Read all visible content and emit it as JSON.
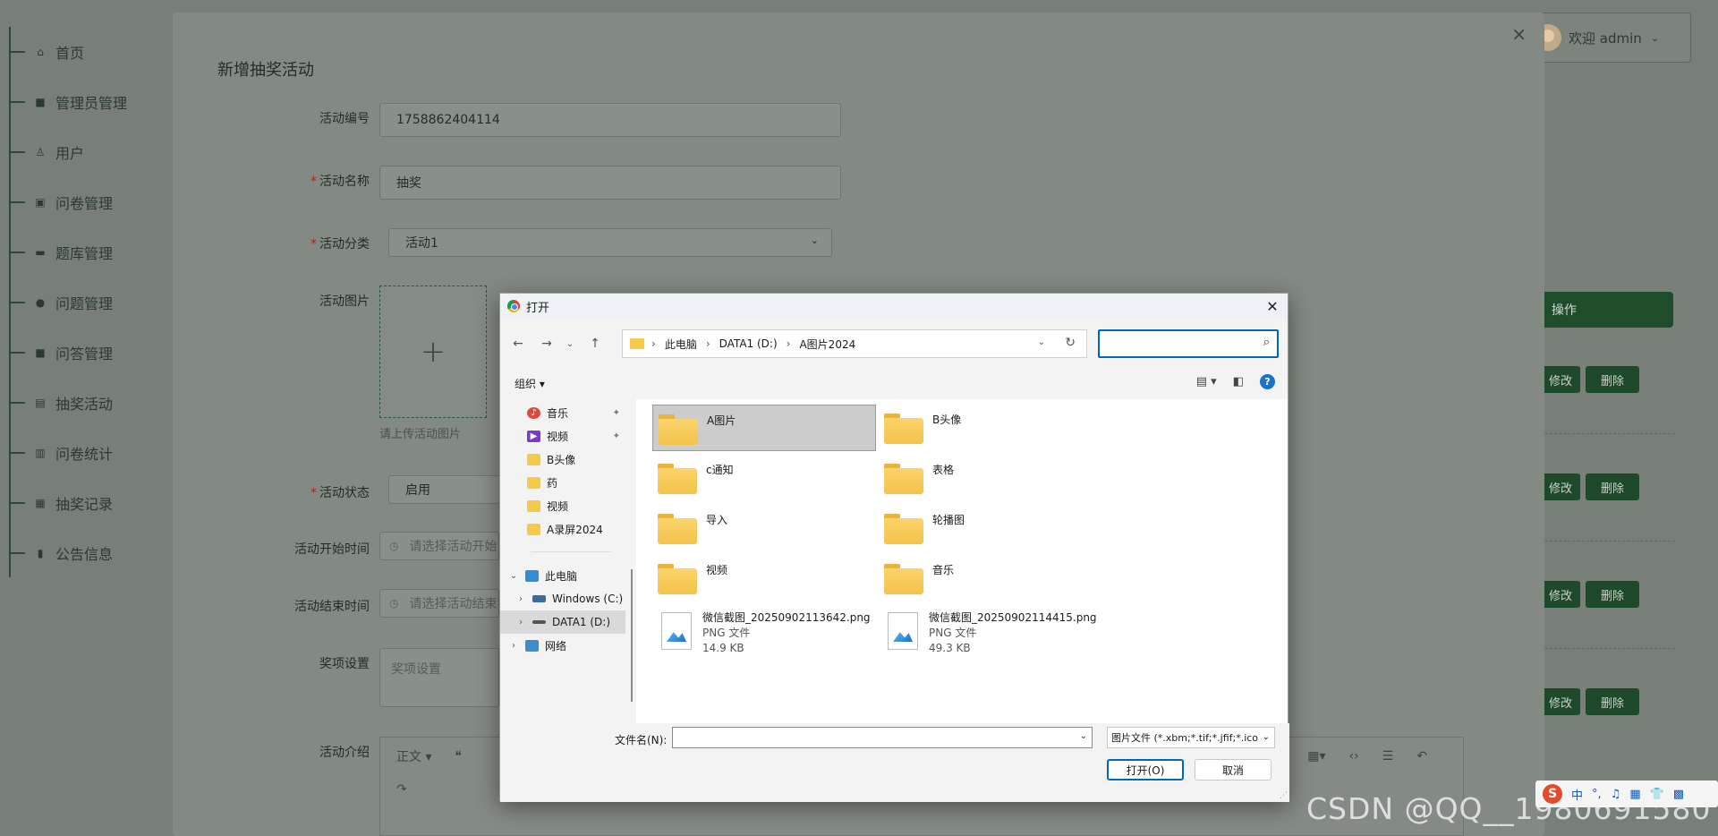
{
  "sidebar": {
    "items": [
      {
        "label": "首页",
        "icon": "home-icon"
      },
      {
        "label": "管理员管理",
        "icon": "admin-icon"
      },
      {
        "label": "用户",
        "icon": "user-icon"
      },
      {
        "label": "问卷管理",
        "icon": "survey-icon"
      },
      {
        "label": "题库管理",
        "icon": "question-bank-icon"
      },
      {
        "label": "问题管理",
        "icon": "question-icon"
      },
      {
        "label": "问答管理",
        "icon": "qa-icon"
      },
      {
        "label": "抽奖活动",
        "icon": "lottery-icon"
      },
      {
        "label": "问卷统计",
        "icon": "stats-icon"
      },
      {
        "label": "抽奖记录",
        "icon": "record-icon"
      },
      {
        "label": "公告信息",
        "icon": "notice-icon"
      }
    ]
  },
  "header": {
    "user_greeting": "欢迎 admin"
  },
  "table": {
    "ops_header": "操作",
    "edit_label": "修改",
    "delete_label": "删除"
  },
  "modal": {
    "title": "新增抽奖活动",
    "fields": {
      "code_label": "活动编号",
      "code_value": "1758862404114",
      "name_label": "活动名称",
      "name_value": "抽奖",
      "category_label": "活动分类",
      "category_value": "活动1",
      "image_label": "活动图片",
      "image_hint": "请上传活动图片",
      "status_label": "活动状态",
      "status_value": "启用",
      "start_label": "活动开始时间",
      "start_placeholder": "请选择活动开始",
      "end_label": "活动结束时间",
      "end_placeholder": "请选择活动结束",
      "prize_label": "奖项设置",
      "prize_placeholder": "奖项设置",
      "intro_label": "活动介绍",
      "editor_style": "正文"
    }
  },
  "dialog": {
    "title": "打开",
    "breadcrumb": [
      "此电脑",
      "DATA1 (D:)",
      "A图片2024"
    ],
    "organize": "组织",
    "nav_items": [
      {
        "label": "音乐",
        "type": "music",
        "pinned": true
      },
      {
        "label": "视频",
        "type": "video",
        "pinned": true
      },
      {
        "label": "B头像",
        "type": "folder"
      },
      {
        "label": "药",
        "type": "folder"
      },
      {
        "label": "视频",
        "type": "folder"
      },
      {
        "label": "A录屏2024",
        "type": "folder"
      },
      {
        "label": "此电脑",
        "type": "pc"
      },
      {
        "label": "Windows (C:)",
        "type": "drive"
      },
      {
        "label": "DATA1 (D:)",
        "type": "drive",
        "selected": true
      },
      {
        "label": "网络",
        "type": "network"
      }
    ],
    "folders": [
      "A图片",
      "B头像",
      "c通知",
      "表格",
      "导入",
      "轮播图",
      "视频",
      "音乐"
    ],
    "files": [
      {
        "name": "微信截图_20250902113642.png",
        "type": "PNG 文件",
        "size": "14.9 KB"
      },
      {
        "name": "微信截图_20250902114415.png",
        "type": "PNG 文件",
        "size": "49.3 KB"
      }
    ],
    "filename_label": "文件名(N):",
    "filetype_value": "图片文件 (*.xbm;*.tif;*.jfif;*.ico",
    "open_button": "打开(O)",
    "cancel_button": "取消"
  },
  "watermark": "CSDN @QQ__1980691580",
  "ime": {
    "lang": "中"
  }
}
